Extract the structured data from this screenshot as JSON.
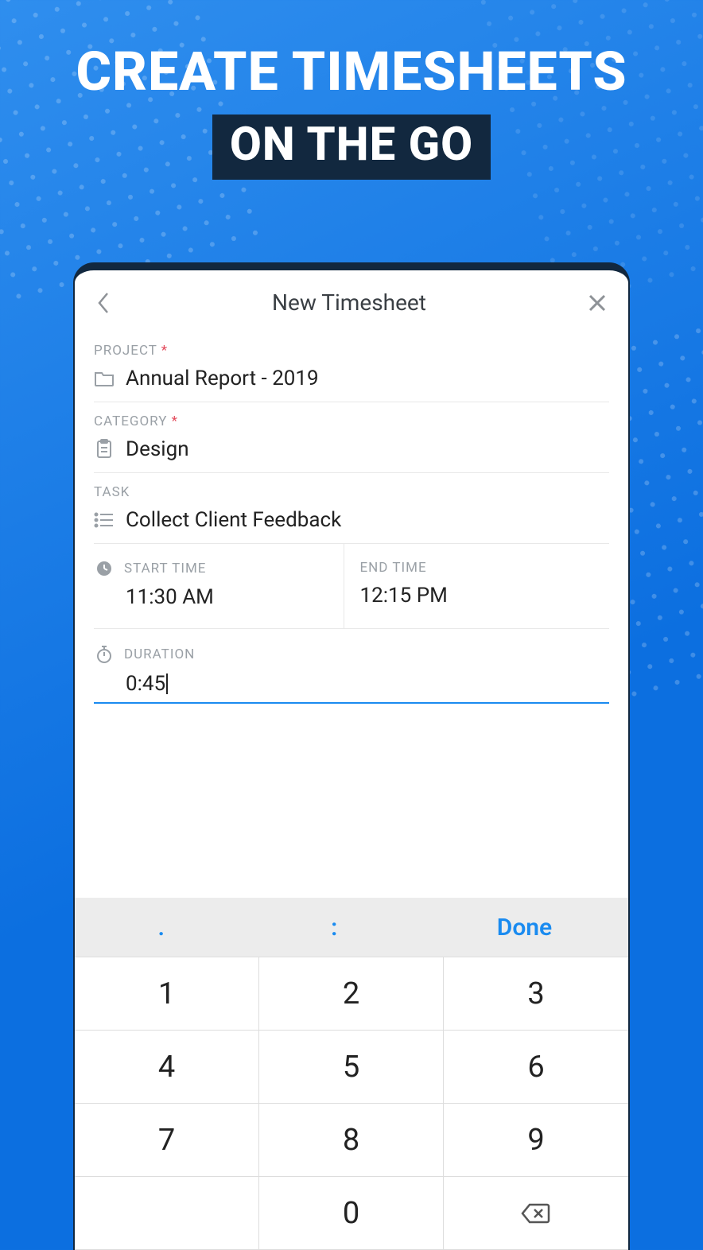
{
  "hero": {
    "line1": "CREATE TIMESHEETS",
    "line2": "ON THE GO"
  },
  "screen": {
    "title": "New Timesheet"
  },
  "fields": {
    "project": {
      "label": "PROJECT",
      "required": true,
      "value": "Annual Report - 2019"
    },
    "category": {
      "label": "CATEGORY",
      "required": true,
      "value": "Design"
    },
    "task": {
      "label": "TASK",
      "required": false,
      "value": "Collect Client Feedback"
    },
    "start_time": {
      "label": "START TIME",
      "value": "11:30 AM"
    },
    "end_time": {
      "label": "END TIME",
      "value": "12:15 PM"
    },
    "duration": {
      "label": "DURATION",
      "value": "0:45"
    }
  },
  "keyboard": {
    "toolbar": {
      "dot": ".",
      "colon": ":",
      "done": "Done"
    },
    "keys": [
      "1",
      "2",
      "3",
      "4",
      "5",
      "6",
      "7",
      "8",
      "9",
      "",
      "0",
      "backspace"
    ]
  }
}
